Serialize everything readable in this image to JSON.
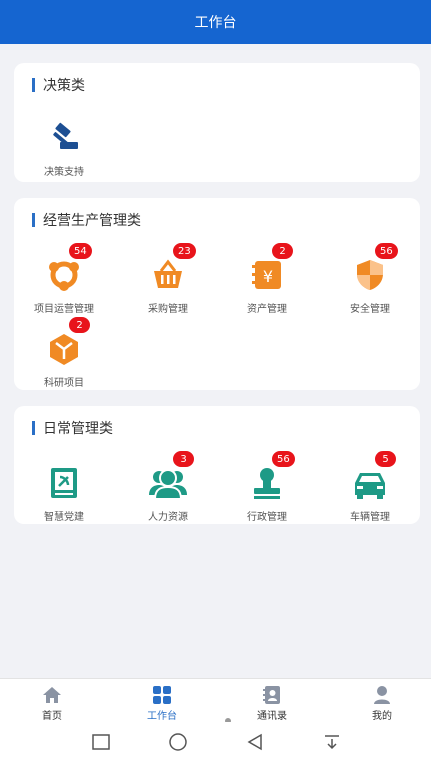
{
  "header": {
    "title": "工作台"
  },
  "sections": {
    "decision": {
      "title": "决策类",
      "items": [
        {
          "label": "决策支持",
          "icon": "gavel-icon"
        }
      ]
    },
    "operations": {
      "title": "经营生产管理类",
      "items": [
        {
          "label": "项目运营管理",
          "badge": "54",
          "icon": "network-icon"
        },
        {
          "label": "采购管理",
          "badge": "23",
          "icon": "basket-icon"
        },
        {
          "label": "资产管理",
          "badge": "2",
          "icon": "yen-notebook-icon"
        },
        {
          "label": "安全管理",
          "badge": "56",
          "icon": "shield-icon"
        },
        {
          "label": "科研项目",
          "badge": "2",
          "icon": "cube-icon"
        }
      ]
    },
    "daily": {
      "title": "日常管理类",
      "items": [
        {
          "label": "智慧党建",
          "icon": "party-book-icon"
        },
        {
          "label": "人力资源",
          "badge": "3",
          "icon": "people-icon"
        },
        {
          "label": "行政管理",
          "badge": "56",
          "icon": "stamp-icon"
        },
        {
          "label": "车辆管理",
          "badge": "5",
          "icon": "car-icon"
        }
      ]
    }
  },
  "tabbar": {
    "items": [
      {
        "label": "首页",
        "icon": "home-icon"
      },
      {
        "label": "工作台",
        "icon": "grid-icon",
        "active": true
      },
      {
        "label": "通讯录",
        "icon": "contacts-icon"
      },
      {
        "label": "我的",
        "icon": "user-icon"
      }
    ]
  },
  "colors": {
    "primary": "#1565d0",
    "orange": "#f08a24",
    "teal": "#1e9a86",
    "badge": "#e8141b"
  }
}
